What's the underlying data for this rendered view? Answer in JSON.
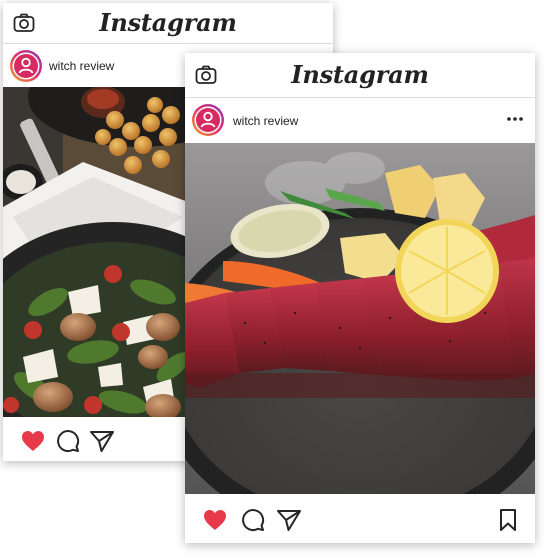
{
  "brand": "Instagram",
  "posts": [
    {
      "username": "witch review",
      "photo_subject": "fried tots and shrimp caesar salad"
    },
    {
      "username": "witch review",
      "photo_subject": "seared beef with lemon on stone plate"
    }
  ],
  "colors": {
    "like_red": "#e8394a",
    "avatar_gradient_start": "#f5a623",
    "avatar_gradient_mid": "#e1306c",
    "avatar_gradient_end": "#8a3ab9",
    "icon_dark": "#262626"
  },
  "icons": [
    "camera-icon",
    "heart-icon",
    "comment-icon",
    "share-icon",
    "more-icon",
    "bookmark-icon"
  ]
}
